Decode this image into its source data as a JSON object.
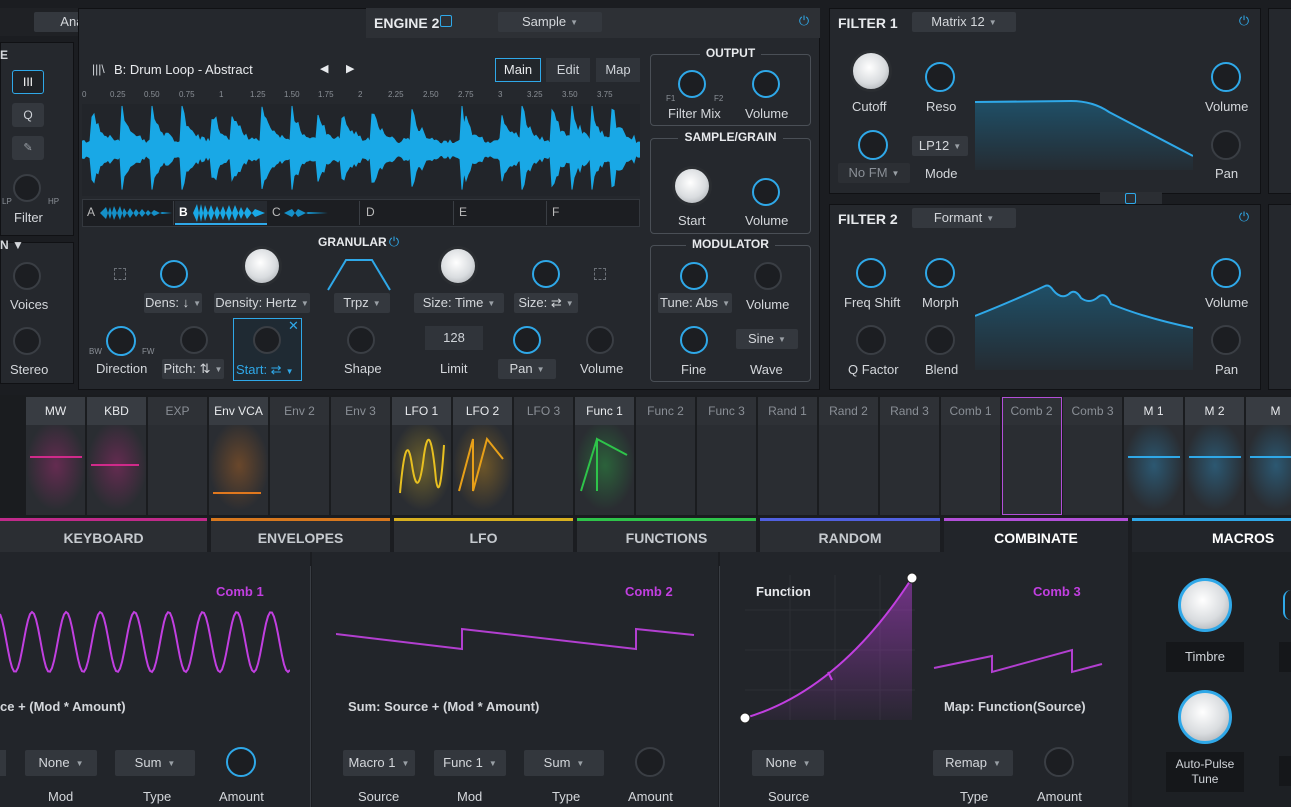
{
  "engine1": {
    "mode": "Analog"
  },
  "engine2": {
    "title": "ENGINE 2",
    "mode": "Sample",
    "sample_name": "B:  Drum Loop - Abstract",
    "view_tabs": [
      "Main",
      "Edit",
      "Map"
    ],
    "active_view": "Main",
    "ruler": [
      "0",
      "0.25",
      "0.50",
      "0.75",
      "1",
      "1.25",
      "1.50",
      "1.75",
      "2",
      "2.25",
      "2.50",
      "2.75",
      "3",
      "3.25",
      "3.50",
      "3.75"
    ],
    "slots": [
      "A",
      "B",
      "C",
      "D",
      "E",
      "F"
    ],
    "output": {
      "title": "OUTPUT",
      "filter_mix": "Filter Mix",
      "f1": "F1",
      "f2": "F2",
      "volume": "Volume"
    },
    "sample_grain": {
      "title": "SAMPLE/GRAIN",
      "start": "Start",
      "volume": "Volume"
    },
    "modulator": {
      "title": "MODULATOR",
      "tune": "Tune: Abs",
      "volume": "Volume",
      "fine": "Fine",
      "wave_value": "Sine",
      "wave": "Wave"
    },
    "granular": {
      "title": "GRANULAR",
      "dens": "Dens: ↓",
      "density": "Density: Hertz",
      "trpz": "Trpz",
      "size_time": "Size: Time",
      "size": "Size: ⇄",
      "direction": "Direction",
      "bw": "BW",
      "fw": "FW",
      "pitch": "Pitch: ⇅",
      "start": "Start: ⇄",
      "shape": "Shape",
      "limit_value": "128",
      "limit": "Limit",
      "pan": "Pan",
      "volume": "Volume"
    }
  },
  "left_strip": {
    "e": "E",
    "q": "Q",
    "filter": "Filter",
    "lp": "LP",
    "hp": "HP",
    "n": "N ▼",
    "voices": "Voices",
    "stereo": "Stereo"
  },
  "filter1": {
    "title": "FILTER 1",
    "type": "Matrix 12",
    "cutoff": "Cutoff",
    "reso": "Reso",
    "volume": "Volume",
    "fm": "No FM",
    "mode_value": "LP12",
    "mode": "Mode",
    "pan": "Pan"
  },
  "filter2": {
    "title": "FILTER 2",
    "type": "Formant",
    "freq_shift": "Freq Shift",
    "morph": "Morph",
    "volume": "Volume",
    "q_factor": "Q Factor",
    "blend": "Blend",
    "pan": "Pan"
  },
  "mod_sources": [
    {
      "name": "MW",
      "active": true,
      "color": "#d02a8a"
    },
    {
      "name": "KBD",
      "active": true,
      "color": "#d02a8a"
    },
    {
      "name": "EXP",
      "active": false,
      "color": ""
    },
    {
      "name": "Env VCA",
      "active": true,
      "color": "#e0781e"
    },
    {
      "name": "Env 2",
      "active": false,
      "color": ""
    },
    {
      "name": "Env 3",
      "active": false,
      "color": ""
    },
    {
      "name": "LFO 1",
      "active": true,
      "color": "#e8c020"
    },
    {
      "name": "LFO 2",
      "active": true,
      "color": "#e8a018"
    },
    {
      "name": "LFO 3",
      "active": false,
      "color": ""
    },
    {
      "name": "Func 1",
      "active": true,
      "color": "#2ec44a"
    },
    {
      "name": "Func 2",
      "active": false,
      "color": ""
    },
    {
      "name": "Func 3",
      "active": false,
      "color": ""
    },
    {
      "name": "Rand 1",
      "active": false,
      "color": ""
    },
    {
      "name": "Rand 2",
      "active": false,
      "color": ""
    },
    {
      "name": "Rand 3",
      "active": false,
      "color": ""
    },
    {
      "name": "Comb 1",
      "active": false,
      "color": ""
    },
    {
      "name": "Comb 2",
      "active": false,
      "color": ""
    },
    {
      "name": "Comb 3",
      "active": false,
      "color": ""
    },
    {
      "name": "M 1",
      "active": true,
      "color": "#2fa8e8"
    },
    {
      "name": "M 2",
      "active": true,
      "color": "#2fa8e8"
    },
    {
      "name": "M",
      "active": true,
      "color": "#2fa8e8"
    }
  ],
  "tabs": [
    {
      "label": "KEYBOARD",
      "color": "#c02a8a"
    },
    {
      "label": "ENVELOPES",
      "color": "#d8781e"
    },
    {
      "label": "LFO",
      "color": "#d8b020"
    },
    {
      "label": "FUNCTIONS",
      "color": "#2ec44a"
    },
    {
      "label": "RANDOM",
      "color": "#5060e0"
    },
    {
      "label": "COMBINATE",
      "color": "#b24fd8"
    },
    {
      "label": "MACROS",
      "color": "#2fa8e8"
    }
  ],
  "combinate": {
    "comb1": {
      "title": "Comb 1",
      "formula": "ce + (Mod * Amount)",
      "mod_value": "None",
      "mod": "Mod",
      "type_value": "Sum",
      "type": "Type",
      "amount": "Amount"
    },
    "comb2": {
      "title": "Comb 2",
      "formula": "Sum: Source + (Mod * Amount)",
      "source_value": "Macro 1",
      "source": "Source",
      "mod_value": "Func 1",
      "mod": "Mod",
      "type_value": "Sum",
      "type": "Type",
      "amount": "Amount"
    },
    "comb3": {
      "function_title": "Function",
      "title": "Comb 3",
      "formula": "Map: Function(Source)",
      "source_value": "None",
      "source": "Source",
      "type_value": "Remap",
      "type": "Type",
      "amount": "Amount"
    }
  },
  "macros": {
    "timbre": "Timbre",
    "auto_pulse": "Auto-Pulse Tune"
  }
}
